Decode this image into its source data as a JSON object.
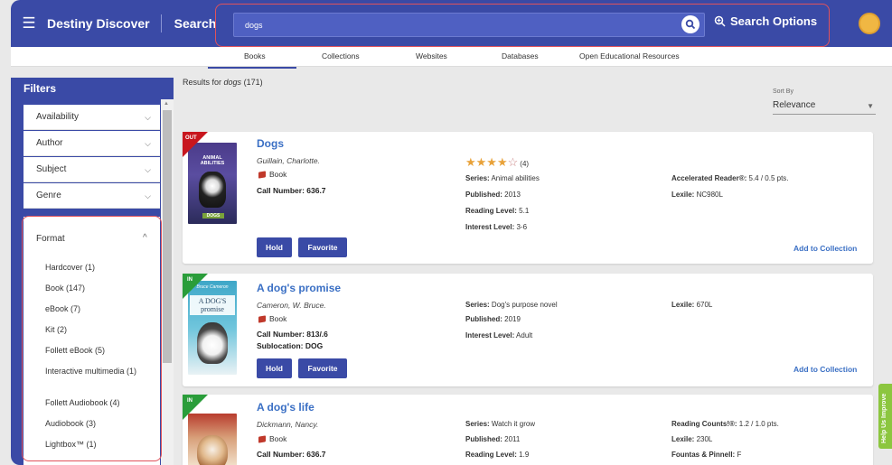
{
  "header": {
    "brand": "Destiny Discover",
    "search_link": "Search",
    "query": "dogs",
    "search_options": "Search Options"
  },
  "tabs": [
    "Books",
    "Collections",
    "Websites",
    "Databases",
    "Open Educational Resources"
  ],
  "sidebar": {
    "title": "Filters",
    "filters": [
      "Availability",
      "Author",
      "Subject",
      "Genre"
    ],
    "format_label": "Format",
    "format_options": [
      "Hardcover (1)",
      "Book (147)",
      "eBook (7)",
      "Kit (2)",
      "Follett eBook (5)",
      "Interactive multimedia (1)",
      "Follett Audiobook (4)",
      "Audiobook (3)",
      "Lightbox™ (1)"
    ]
  },
  "results": {
    "prefix": "Results for",
    "query": "dogs",
    "count": "(171)",
    "sort_label": "Sort By",
    "sort_value": "Relevance"
  },
  "labels": {
    "hold": "Hold",
    "favorite": "Favorite",
    "add_to_collection": "Add to Collection",
    "series": "Series:",
    "published": "Published:",
    "reading_level": "Reading Level:",
    "interest_level": "Interest Level:",
    "ar": "Accelerated Reader®:",
    "lexile": "Lexile:",
    "reading_counts": "Reading Counts!®:",
    "fountas": "Fountas & Pinnell:",
    "help": "Help Us Improve"
  },
  "books": [
    {
      "status": "OUT",
      "status_color": "#c8161e",
      "title": "Dogs",
      "author": "Guillain, Charlotte.",
      "format": "Book",
      "call_number": "Call Number: 636.7",
      "rating": 4,
      "rating_count": "(4)",
      "series": "Animal abilities",
      "published": "2013",
      "reading_level": "5.1",
      "interest_level": "3-6",
      "ar": "5.4 / 0.5 pts.",
      "lexile": "NC980L",
      "cover_title": "ANIMAL ABILITIES",
      "cover_bottom": "DOGS"
    },
    {
      "status": "IN",
      "status_color": "#2a9d3a",
      "title": "A dog's promise",
      "author": "Cameron, W. Bruce.",
      "format": "Book",
      "call_number": "Call Number: 813/.6",
      "sublocation": "Sublocation: DOG",
      "series": "Dog's purpose novel",
      "published": "2019",
      "interest_level": "Adult",
      "lexile": "670L",
      "cover_top": "Bruce Cameron",
      "cover_title": "A DOG'S promise"
    },
    {
      "status": "IN",
      "status_color": "#2a9d3a",
      "title": "A dog's life",
      "author": "Dickmann, Nancy.",
      "format": "Book",
      "call_number": "Call Number: 636.7",
      "series": "Watch it grow",
      "published": "2011",
      "reading_level": "1.9",
      "reading_counts": "1.2 / 1.0 pts.",
      "lexile": "230L",
      "fountas": "F"
    }
  ]
}
